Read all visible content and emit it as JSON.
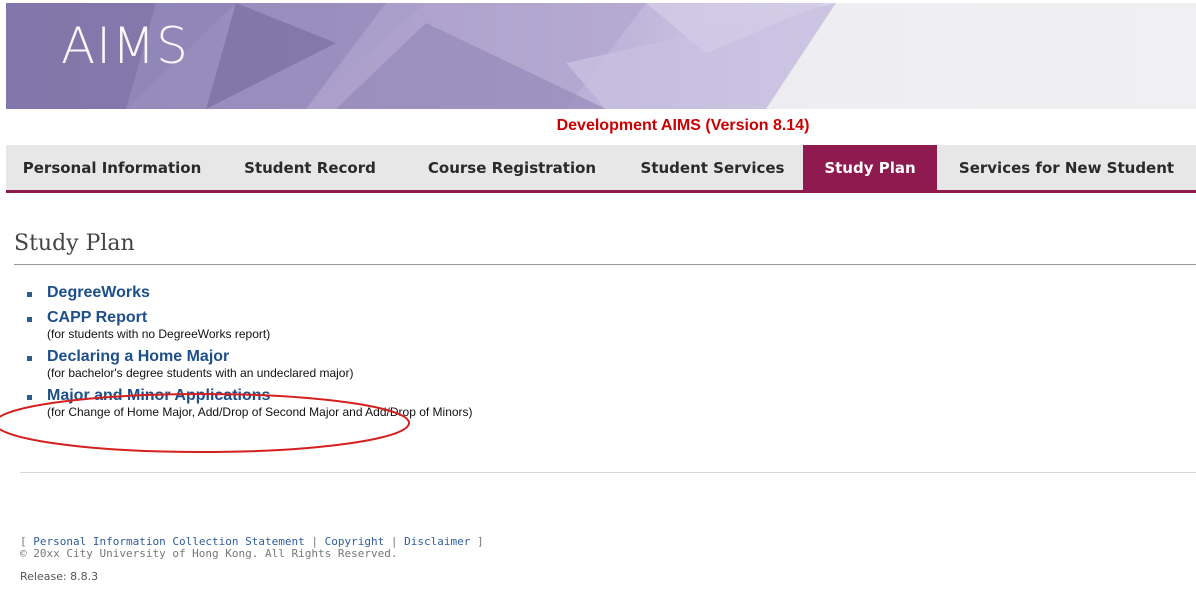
{
  "header": {
    "logo_text": "AIMS",
    "version_text": "Development AIMS (Version 8.14)"
  },
  "nav": {
    "tabs": [
      {
        "label": "Personal Information",
        "active": false
      },
      {
        "label": "Student Record",
        "active": false
      },
      {
        "label": "Course Registration",
        "active": false
      },
      {
        "label": "Student Services",
        "active": false
      },
      {
        "label": "Study Plan",
        "active": true
      },
      {
        "label": "Services for New Student",
        "active": false
      }
    ],
    "active_color": "#8e1a4f"
  },
  "main": {
    "title": "Study Plan",
    "items": [
      {
        "label": "DegreeWorks",
        "desc": ""
      },
      {
        "label": "CAPP Report",
        "desc": "(for students with no DegreeWorks report)"
      },
      {
        "label": "Declaring a Home Major",
        "desc": "(for bachelor's degree students with an undeclared major)"
      },
      {
        "label": "Major and Minor Applications",
        "desc": "(for Change of Home Major, Add/Drop of Second Major and Add/Drop of Minors)",
        "highlighted": true
      }
    ]
  },
  "footer": {
    "open_bracket": "[ ",
    "links": [
      "Personal Information Collection Statement",
      "Copyright",
      "Disclaimer"
    ],
    "separator": " | ",
    "close_bracket": " ]",
    "copyright": "© 20xx City University of Hong Kong. All Rights Reserved.",
    "release": "Release: 8.8.3"
  },
  "colors": {
    "link": "#1d4f8b",
    "version_red": "#cc0000",
    "annotation_oval": "#d62020"
  }
}
